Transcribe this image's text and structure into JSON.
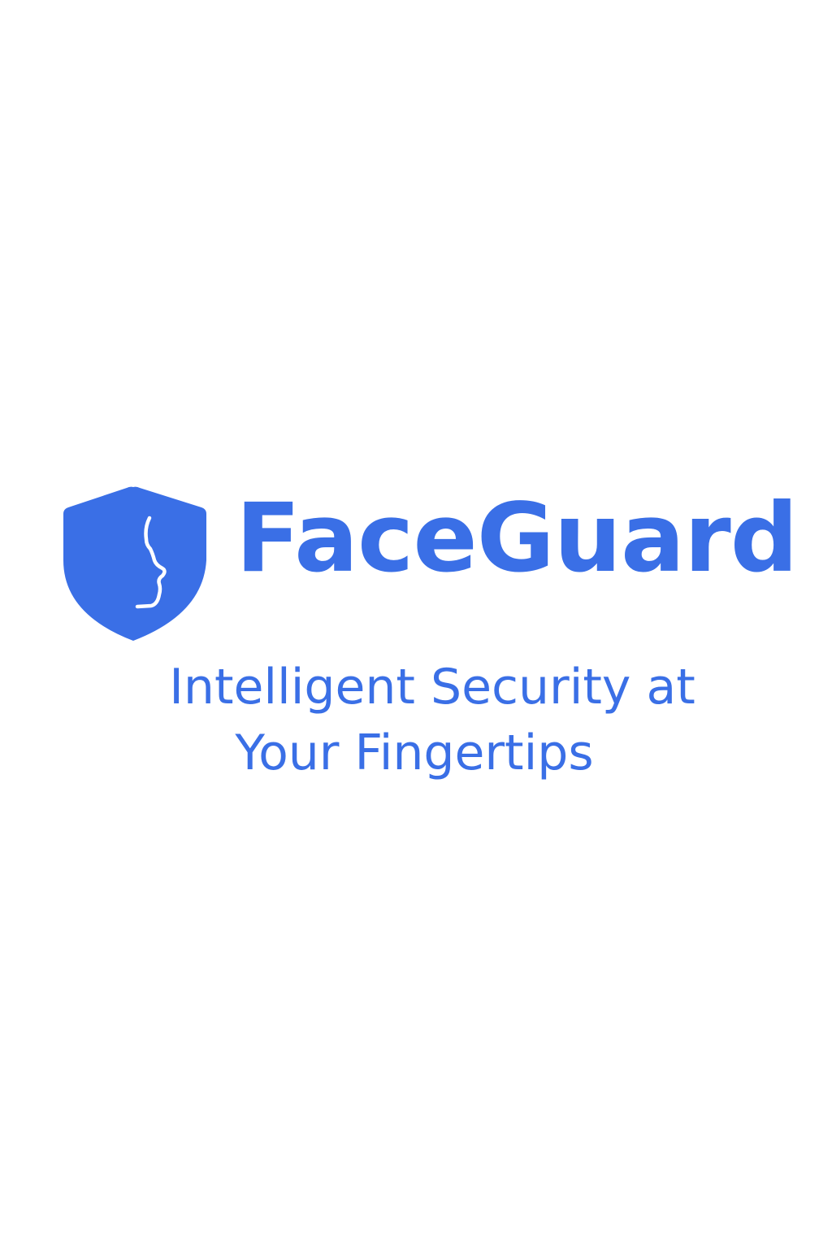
{
  "brand": {
    "name": "FaceGuard",
    "logo_icon": "shield-face-icon",
    "color": "#3a6fe6"
  },
  "tagline": {
    "line1": "Intelligent Security at",
    "line2": "Your Fingertips"
  },
  "background_color": "#ffffff"
}
